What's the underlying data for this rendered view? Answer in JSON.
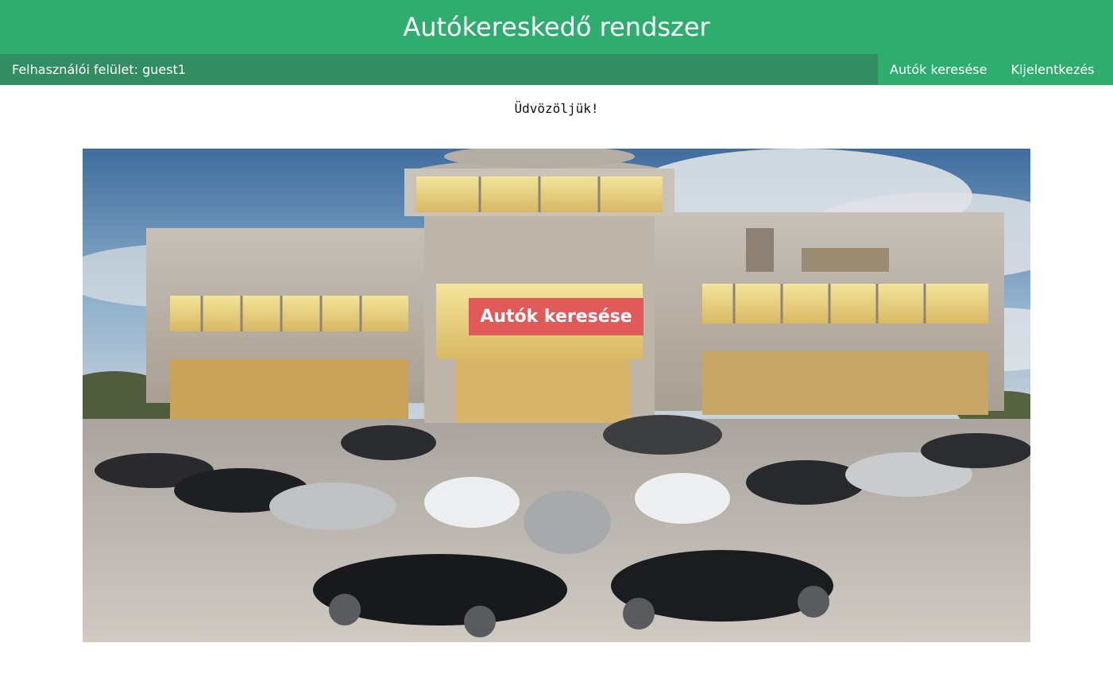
{
  "header": {
    "title": "Autókereskedő rendszer"
  },
  "navbar": {
    "user_label": "Felhasználói felület: guest1",
    "links": [
      {
        "label": "Autók keresése"
      },
      {
        "label": "Kijelentkezés"
      }
    ]
  },
  "main": {
    "welcome_text": "Üdvözöljük!",
    "hero": {
      "button_label": "Autók keresése"
    }
  },
  "colors": {
    "header_bg": "#2fad6f",
    "user_bar_bg": "#338d63",
    "hero_button_bg": "#e05a5a"
  }
}
